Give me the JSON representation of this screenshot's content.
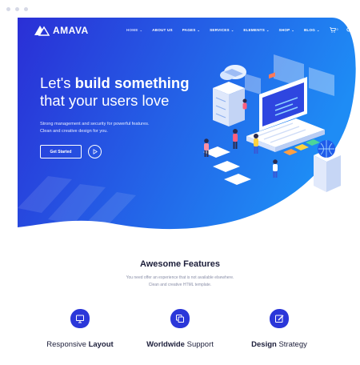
{
  "brand": {
    "name": "AMAVA"
  },
  "nav": {
    "items": [
      {
        "label": "HOME",
        "caret": "⌄"
      },
      {
        "label": "ABOUT US",
        "caret": ""
      },
      {
        "label": "PAGES",
        "caret": "⌄"
      },
      {
        "label": "SERVICES",
        "caret": "⌄"
      },
      {
        "label": "ELEMENTS",
        "caret": "⌄"
      },
      {
        "label": "SHOP",
        "caret": "⌄"
      },
      {
        "label": "BLOG",
        "caret": "⌄"
      }
    ],
    "cart_count": "0"
  },
  "hero": {
    "title_line1_prefix": "Let's ",
    "title_line1_bold": "build something",
    "title_line2": "that your users love",
    "subtitle_line1": "Strong management and security for powerful features.",
    "subtitle_line2": "Clean and creative design for you.",
    "cta_label": "Get Started"
  },
  "features": {
    "title": "Awesome Features",
    "subtitle_line1": "You need offer an experience that is not available elsewhere.",
    "subtitle_line2": "Clean and creative HTML template.",
    "items": [
      {
        "prefix": "Responsive ",
        "bold": "Layout",
        "suffix": "",
        "icon": "monitor-icon"
      },
      {
        "prefix": "",
        "bold": "Worldwide",
        "suffix": " Support",
        "icon": "copy-icon"
      },
      {
        "prefix": "",
        "bold": "Design",
        "suffix": " Strategy",
        "icon": "edit-icon"
      }
    ]
  },
  "colors": {
    "hero_gradient_start": "#2a2fd6",
    "hero_gradient_end": "#1e8cf5",
    "feature_icon_bg": "#2b37d9",
    "heading_text": "#1c1e3a"
  }
}
